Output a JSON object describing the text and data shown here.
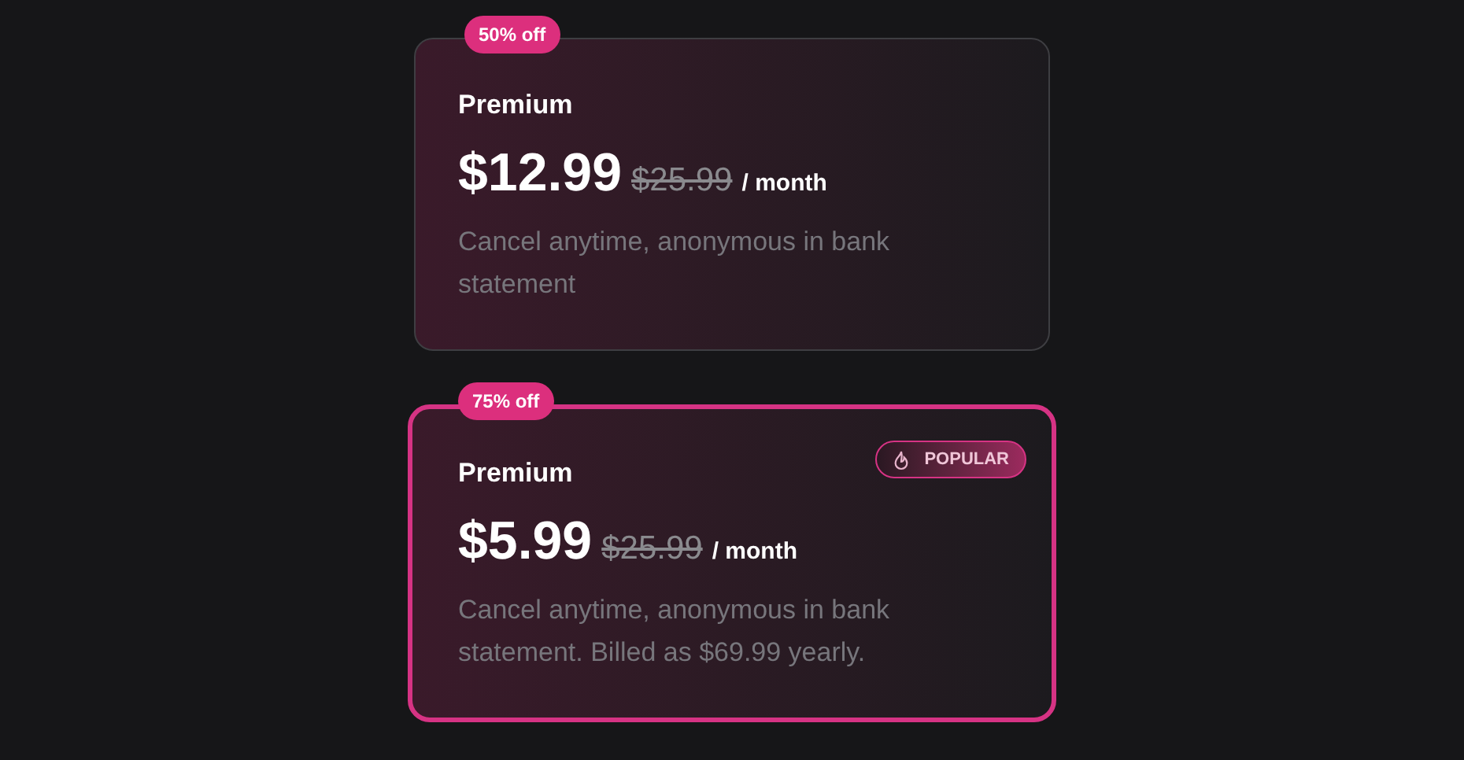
{
  "plans": [
    {
      "discount": "50% off",
      "name": "Premium",
      "price": "$12.99",
      "old_price": "$25.99",
      "period": "/ month",
      "description": "Cancel anytime, anonymous in bank statement",
      "selected": false
    },
    {
      "discount": "75% off",
      "name": "Premium",
      "price": "$5.99",
      "old_price": "$25.99",
      "period": "/ month",
      "description": "Cancel anytime, anonymous in bank statement. Billed as $69.99 yearly.",
      "selected": true,
      "tag": "POPULAR"
    }
  ]
}
